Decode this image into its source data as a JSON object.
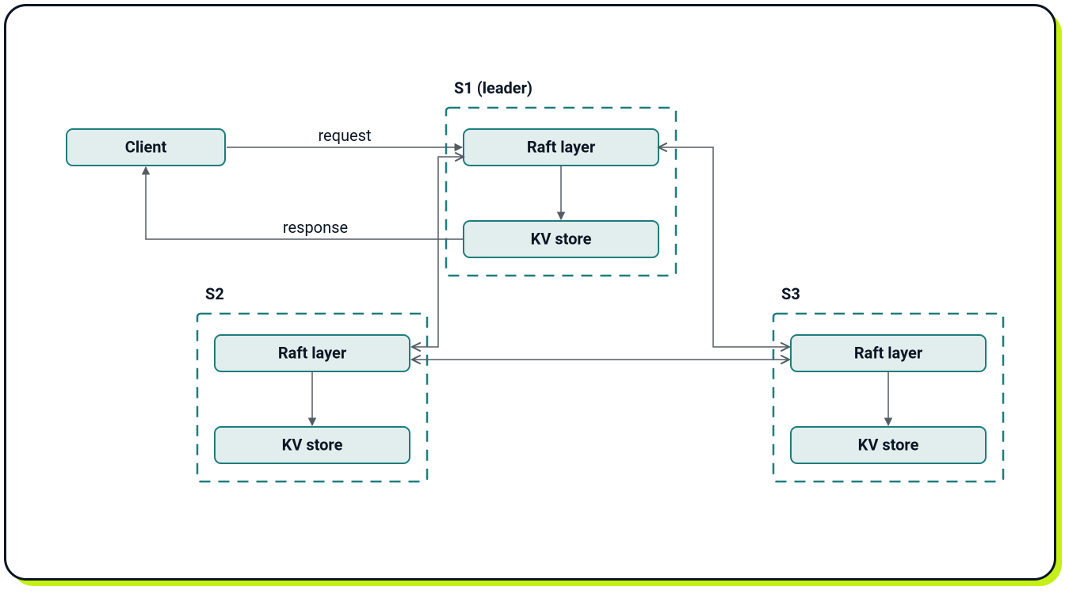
{
  "colors": {
    "card_border": "#0b1624",
    "card_shadow": "#c4f018",
    "node_fill": "#e2eeee",
    "node_stroke": "#1f7c7c",
    "edge": "#555b63"
  },
  "client": {
    "label": "Client"
  },
  "groups": {
    "s1": {
      "title": "S1 (leader)",
      "raft_label": "Raft layer",
      "kv_label": "KV store"
    },
    "s2": {
      "title": "S2",
      "raft_label": "Raft layer",
      "kv_label": "KV store"
    },
    "s3": {
      "title": "S3",
      "raft_label": "Raft layer",
      "kv_label": "KV store"
    }
  },
  "edges": {
    "request_label": "request",
    "response_label": "response"
  }
}
